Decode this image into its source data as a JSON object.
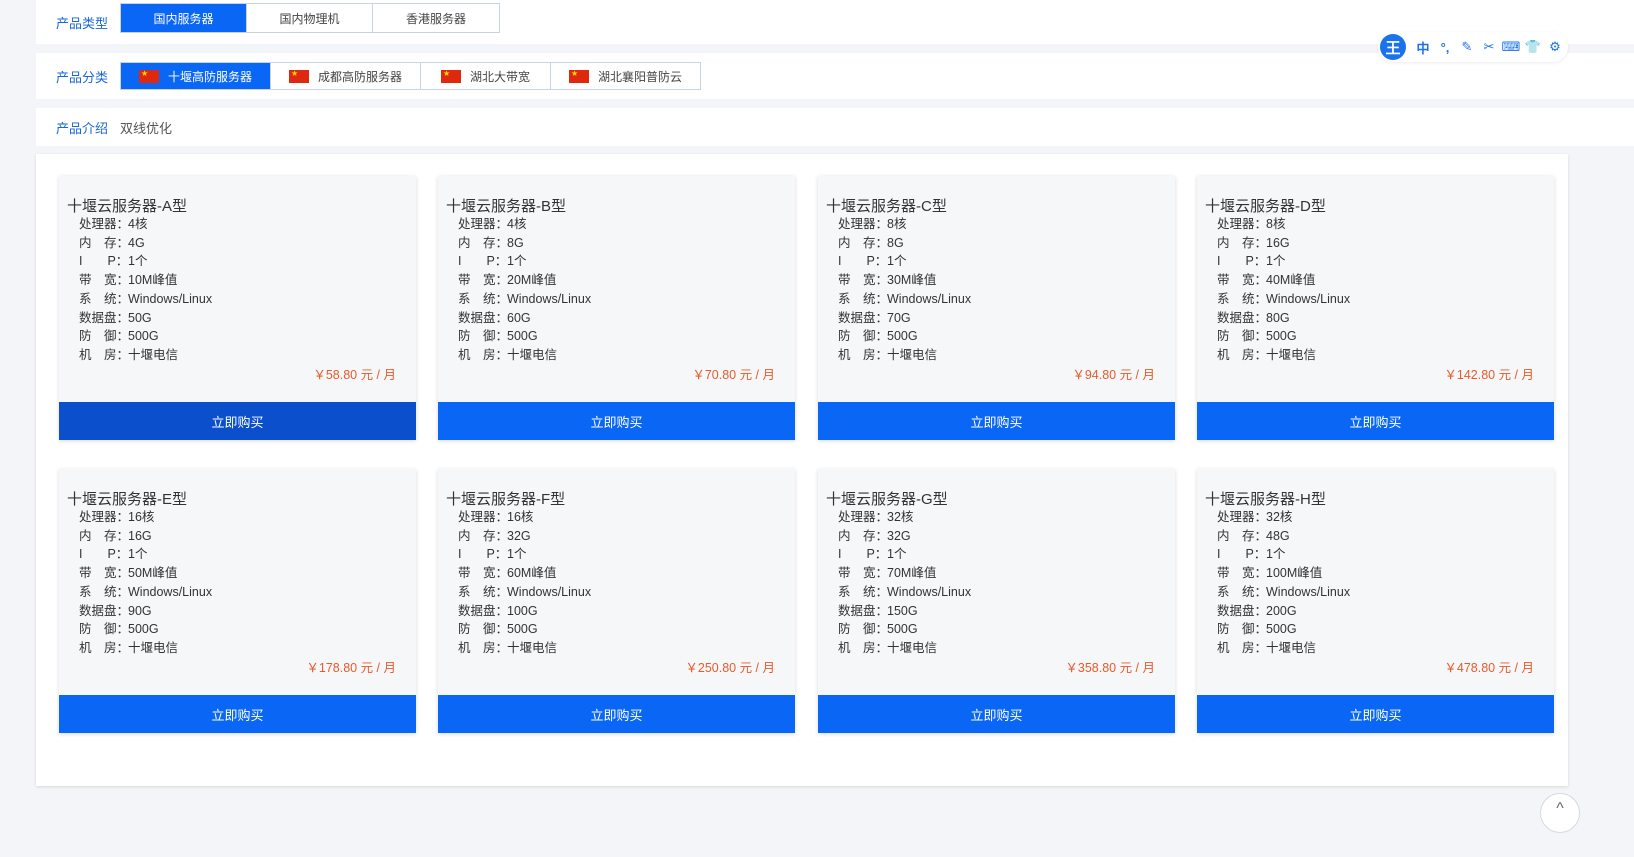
{
  "filters": {
    "product_type": {
      "label": "产品类型",
      "options": [
        "国内服务器",
        "国内物理机",
        "香港服务器"
      ],
      "selected": 0
    },
    "product_category": {
      "label": "产品分类",
      "options": [
        "十堰高防服务器",
        "成都高防服务器",
        "湖北大带宽",
        "湖北襄阳普防云"
      ],
      "selected": 0
    },
    "product_intro": {
      "label": "产品介绍",
      "text": "双线优化"
    }
  },
  "spec_labels": {
    "cpu": "处理器：",
    "ram": "内　存：",
    "ip": "I　　P：",
    "bandwidth": "带　宽：",
    "os": "系　统：",
    "disk": "数据盘：",
    "defense": "防　御：",
    "datacenter": "机　房："
  },
  "buy_label": "立即购买",
  "products": [
    {
      "title": "十堰云服务器-A型",
      "cpu": "4核",
      "ram": "4G",
      "ip": "1个",
      "bandwidth": "10M峰值",
      "os": "Windows/Linux",
      "disk": "50G",
      "defense": "500G",
      "datacenter": "十堰电信",
      "price": "￥58.80 元 / 月"
    },
    {
      "title": "十堰云服务器-B型",
      "cpu": "4核",
      "ram": "8G",
      "ip": "1个",
      "bandwidth": "20M峰值",
      "os": "Windows/Linux",
      "disk": "60G",
      "defense": "500G",
      "datacenter": "十堰电信",
      "price": "￥70.80 元 / 月"
    },
    {
      "title": "十堰云服务器-C型",
      "cpu": "8核",
      "ram": "8G",
      "ip": "1个",
      "bandwidth": "30M峰值",
      "os": "Windows/Linux",
      "disk": "70G",
      "defense": "500G",
      "datacenter": "十堰电信",
      "price": "￥94.80 元 / 月"
    },
    {
      "title": "十堰云服务器-D型",
      "cpu": "8核",
      "ram": "16G",
      "ip": "1个",
      "bandwidth": "40M峰值",
      "os": "Windows/Linux",
      "disk": "80G",
      "defense": "500G",
      "datacenter": "十堰电信",
      "price": "￥142.80 元 / 月"
    },
    {
      "title": "十堰云服务器-E型",
      "cpu": "16核",
      "ram": "16G",
      "ip": "1个",
      "bandwidth": "50M峰值",
      "os": "Windows/Linux",
      "disk": "90G",
      "defense": "500G",
      "datacenter": "十堰电信",
      "price": "￥178.80 元 / 月"
    },
    {
      "title": "十堰云服务器-F型",
      "cpu": "16核",
      "ram": "32G",
      "ip": "1个",
      "bandwidth": "60M峰值",
      "os": "Windows/Linux",
      "disk": "100G",
      "defense": "500G",
      "datacenter": "十堰电信",
      "price": "￥250.80 元 / 月"
    },
    {
      "title": "十堰云服务器-G型",
      "cpu": "32核",
      "ram": "32G",
      "ip": "1个",
      "bandwidth": "70M峰值",
      "os": "Windows/Linux",
      "disk": "150G",
      "defense": "500G",
      "datacenter": "十堰电信",
      "price": "￥358.80 元 / 月"
    },
    {
      "title": "十堰云服务器-H型",
      "cpu": "32核",
      "ram": "48G",
      "ip": "1个",
      "bandwidth": "100M峰值",
      "os": "Windows/Linux",
      "disk": "200G",
      "defense": "500G",
      "datacenter": "十堰电信",
      "price": "￥478.80 元 / 月"
    }
  ],
  "toolbar": {
    "logo": "王",
    "buttons": [
      {
        "icon": "chinese-input-icon",
        "glyph": "中"
      },
      {
        "icon": "punctuation-icon",
        "glyph": "°,"
      },
      {
        "icon": "pen-icon",
        "glyph": "✎"
      },
      {
        "icon": "scissors-icon",
        "glyph": "✂"
      },
      {
        "icon": "keyboard-icon",
        "glyph": "⌨"
      },
      {
        "icon": "skin-icon",
        "glyph": "👕"
      },
      {
        "icon": "settings-icon",
        "glyph": "⚙"
      }
    ]
  },
  "scroll_top_glyph": "^",
  "colors": {
    "accent": "#0a67f5",
    "accent_pressed": "#0b4fcc",
    "label_blue": "#1a66d8",
    "price": "#e85a2b",
    "flag_red": "#de2910"
  }
}
